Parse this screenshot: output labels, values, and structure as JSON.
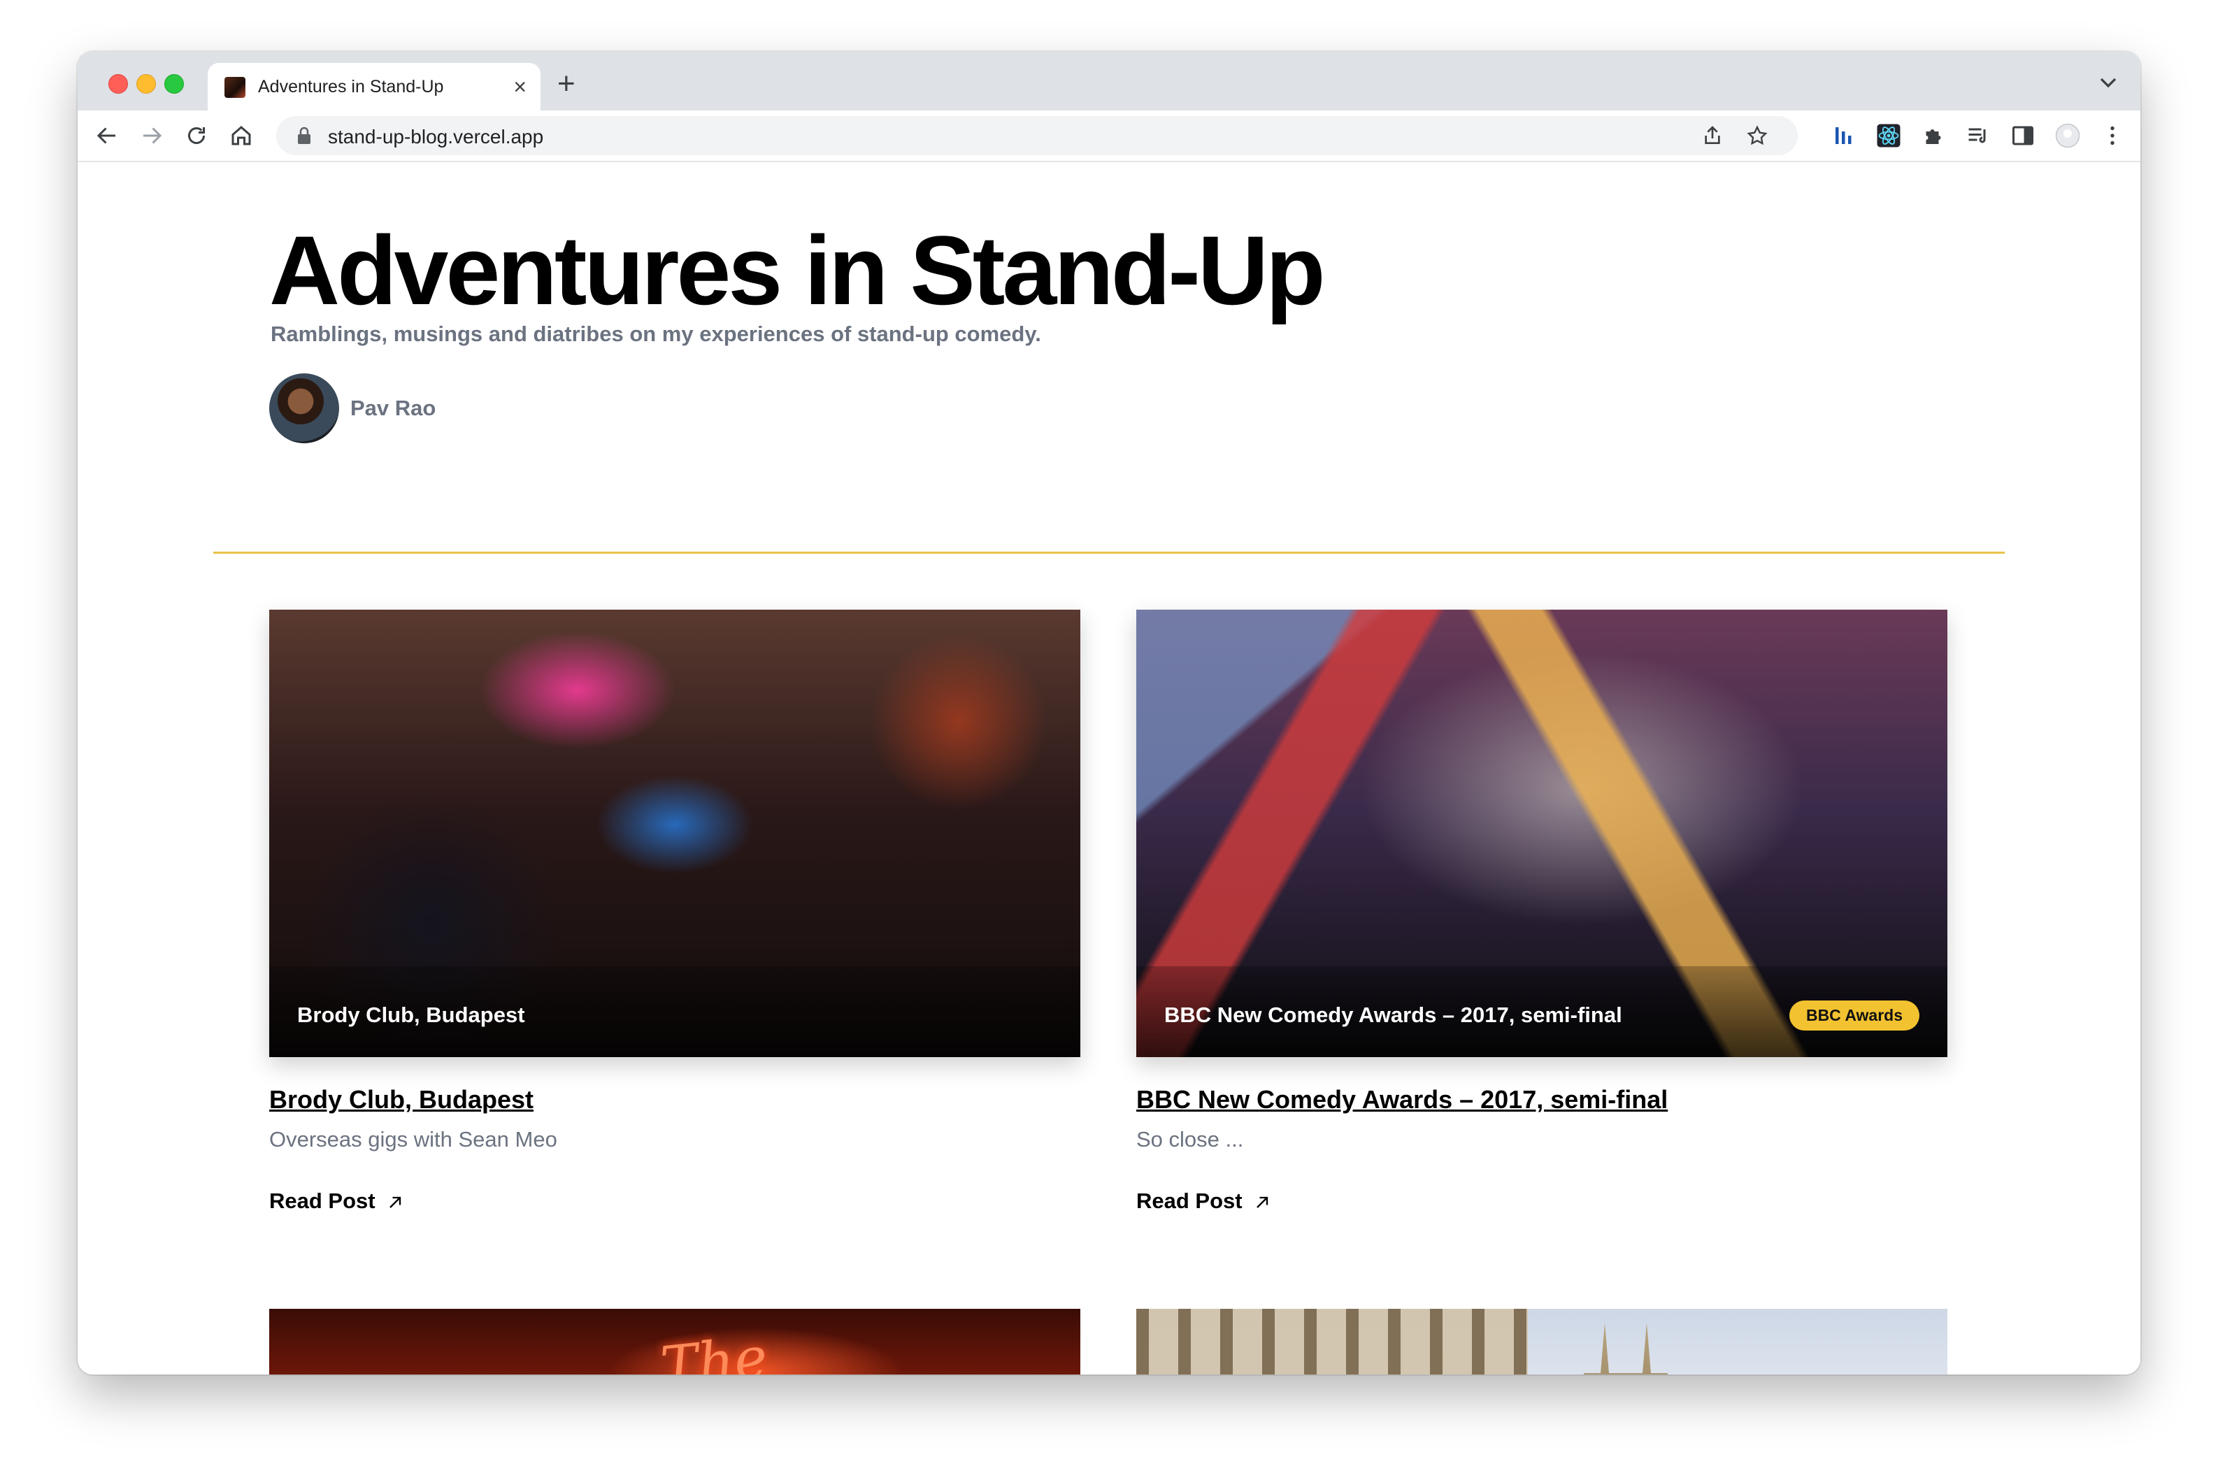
{
  "browser": {
    "tab_title": "Adventures in Stand-Up",
    "tab_close": "×",
    "new_tab": "+",
    "url": "stand-up-blog.vercel.app"
  },
  "blog": {
    "title": "Adventures in Stand-Up",
    "tagline": "Ramblings, musings and diatribes on my experiences of stand-up comedy.",
    "author": "Pav Rao",
    "divider_color": "#e8c34a"
  },
  "posts": [
    {
      "image_caption": "Brody Club, Budapest",
      "title": "Brody Club, Budapest",
      "excerpt": "Overseas gigs with Sean Meo",
      "read_more": "Read Post"
    },
    {
      "image_caption": "BBC New Comedy Awards – 2017, semi-final",
      "badge": "BBC Awards",
      "title": "BBC New Comedy Awards – 2017, semi-final",
      "excerpt": "So close ...",
      "read_more": "Read Post"
    }
  ],
  "colors": {
    "badge": "#f2c230",
    "muted_text": "#6b7280",
    "accent_line": "#e8c34a"
  }
}
